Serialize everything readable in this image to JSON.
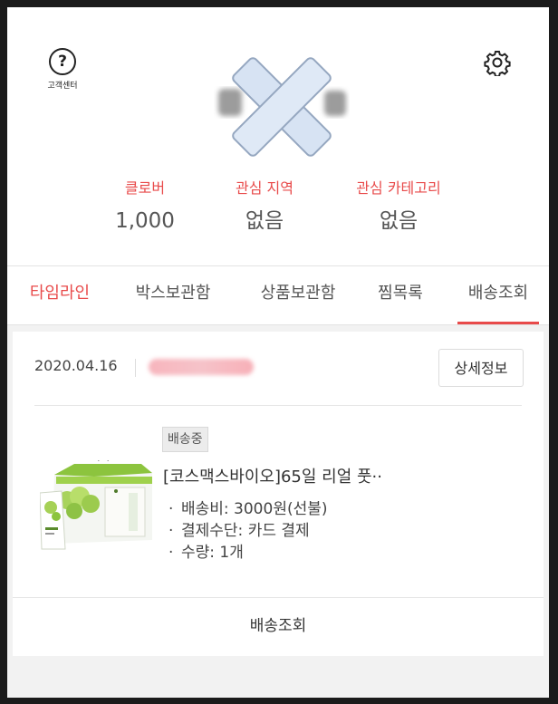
{
  "header": {
    "help_label": "고객센터"
  },
  "stats": [
    {
      "label": "클로버",
      "value": "1,000"
    },
    {
      "label": "관심 지역",
      "value": "없음"
    },
    {
      "label": "관심 카테고리",
      "value": "없음"
    }
  ],
  "tabs": [
    {
      "label": "타임라인"
    },
    {
      "label": "박스보관함"
    },
    {
      "label": "상품보관함"
    },
    {
      "label": "찜목록"
    },
    {
      "label": "배송조회"
    }
  ],
  "order": {
    "date": "2020.04.16",
    "detail_button": "상세정보",
    "status": "배송중",
    "product_name": "[코스맥스바이오]65일 리얼 풋··",
    "info": [
      "배송비: 3000원(선불)",
      "결제수단: 카드 결제",
      "수량: 1개"
    ],
    "track_button": "배송조회"
  },
  "colors": {
    "accent": "#e84a4a",
    "background": "#f2f2f2"
  }
}
